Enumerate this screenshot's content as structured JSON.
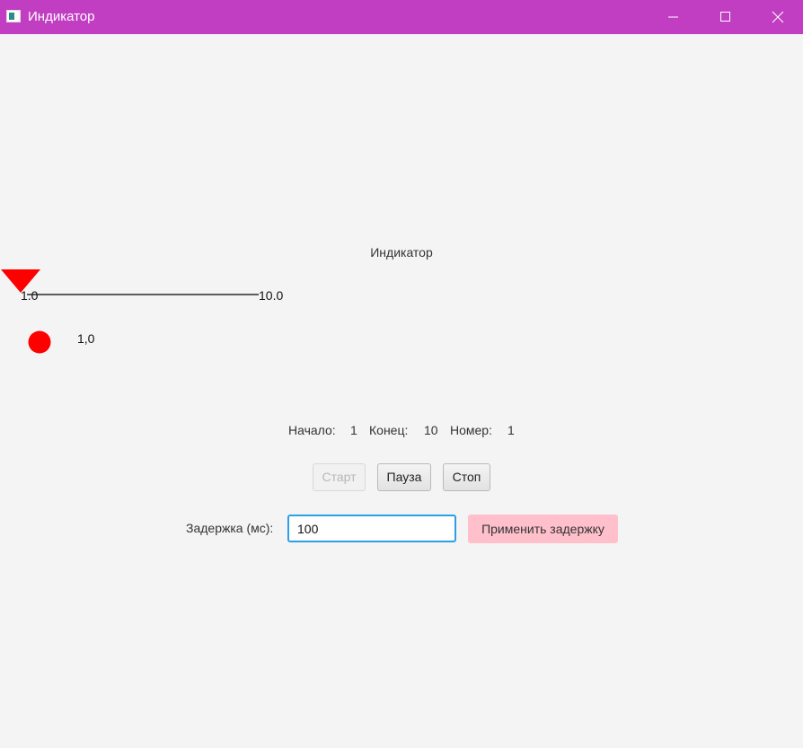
{
  "window": {
    "title": "Индикатор",
    "titlebar_color": "#c13dc1",
    "controls": [
      "minimize-icon",
      "maximize-icon",
      "close-icon"
    ]
  },
  "indicator": {
    "title": "Индикатор",
    "scale_min_label": "1.0",
    "scale_max_label": "10.0",
    "scale_min": 1.0,
    "scale_max": 10.0,
    "current_value": 1.0,
    "value_label": "1,0",
    "marker_color": "#ff0000",
    "lamp_color": "#ff0000"
  },
  "info": {
    "start_label": "Начало:",
    "start_value": "1",
    "end_label": "Конец:",
    "end_value": "10",
    "number_label": "Номер:",
    "number_value": "1"
  },
  "controls": {
    "start_label": "Старт",
    "start_enabled": false,
    "pause_label": "Пауза",
    "stop_label": "Стоп"
  },
  "delay": {
    "label": "Задержка (мс):",
    "value": "100",
    "apply_label": "Применить задержку",
    "apply_color": "#ffc0cb"
  }
}
